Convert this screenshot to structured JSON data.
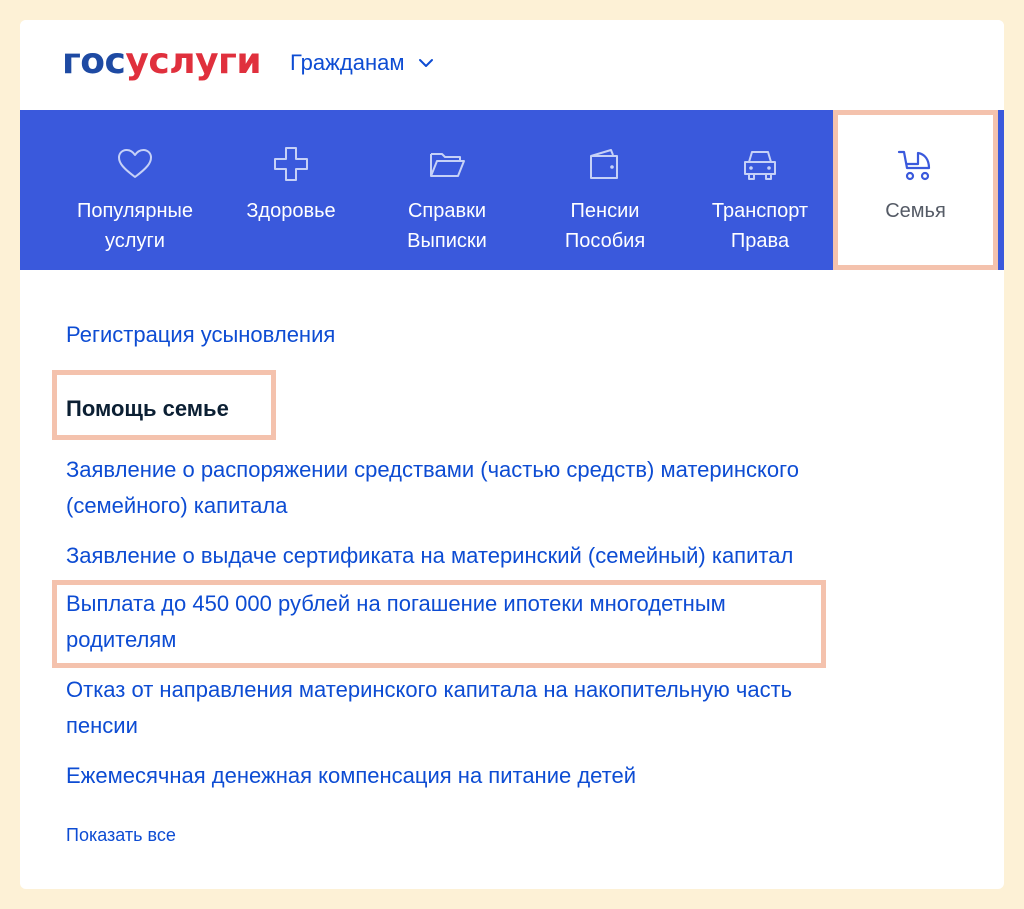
{
  "header": {
    "logo_part1": "гос",
    "logo_part2": "услуги",
    "audience_label": "Гражданам"
  },
  "categories": [
    {
      "icon": "heart-icon",
      "label": "Популярные\nуслуги"
    },
    {
      "icon": "health-cross-icon",
      "label": "Здоровье"
    },
    {
      "icon": "folder-icon",
      "label": "Справки\nВыписки"
    },
    {
      "icon": "wallet-icon",
      "label": "Пенсии\nПособия"
    },
    {
      "icon": "car-icon",
      "label": "Транспорт\nПрава"
    },
    {
      "icon": "stroller-icon",
      "label": "Семья",
      "active": true
    }
  ],
  "content": {
    "link_adoption": "Регистрация усыновления",
    "section_title": "Помощь семье",
    "services": [
      "Заявление о распоряжении средствами (частью средств) материнского\n(семейного) капитала",
      "Заявление о выдаче сертификата на материнский (семейный) капитал",
      "Выплата до 450 000 рублей на погашение ипотеки многодетным\nродителям",
      "Отказ от направления материнского капитала на накопительную часть\nпенсии",
      "Ежемесячная денежная компенсация на питание детей"
    ],
    "show_all": "Показать все"
  },
  "colors": {
    "page_bg": "#fdf1d6",
    "nav_bg": "#3a59dc",
    "link": "#0d4cd3",
    "highlight": "#f4c2ad",
    "logo_blue": "#1e4aa3",
    "logo_red": "#e0303d"
  }
}
